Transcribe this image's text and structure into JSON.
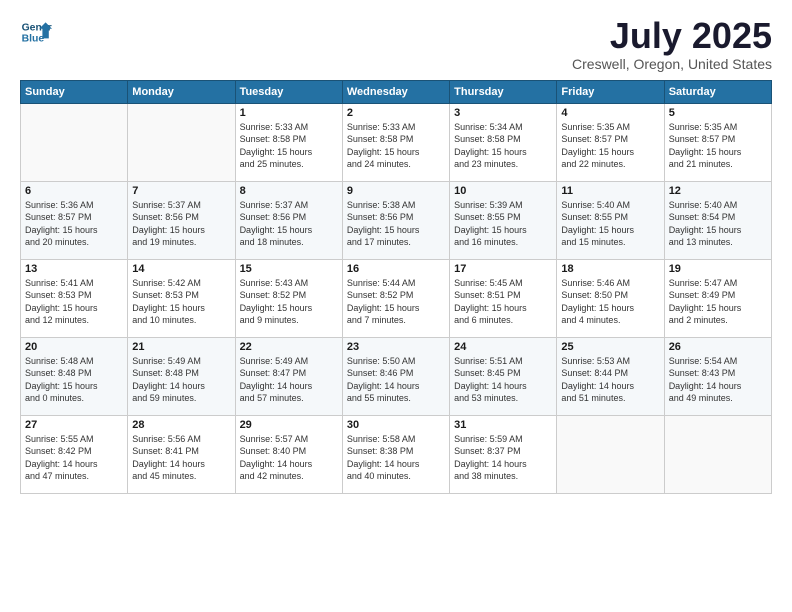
{
  "header": {
    "logo_line1": "General",
    "logo_line2": "Blue",
    "title": "July 2025",
    "subtitle": "Creswell, Oregon, United States"
  },
  "weekdays": [
    "Sunday",
    "Monday",
    "Tuesday",
    "Wednesday",
    "Thursday",
    "Friday",
    "Saturday"
  ],
  "weeks": [
    [
      {
        "day": "",
        "info": ""
      },
      {
        "day": "",
        "info": ""
      },
      {
        "day": "1",
        "info": "Sunrise: 5:33 AM\nSunset: 8:58 PM\nDaylight: 15 hours\nand 25 minutes."
      },
      {
        "day": "2",
        "info": "Sunrise: 5:33 AM\nSunset: 8:58 PM\nDaylight: 15 hours\nand 24 minutes."
      },
      {
        "day": "3",
        "info": "Sunrise: 5:34 AM\nSunset: 8:58 PM\nDaylight: 15 hours\nand 23 minutes."
      },
      {
        "day": "4",
        "info": "Sunrise: 5:35 AM\nSunset: 8:57 PM\nDaylight: 15 hours\nand 22 minutes."
      },
      {
        "day": "5",
        "info": "Sunrise: 5:35 AM\nSunset: 8:57 PM\nDaylight: 15 hours\nand 21 minutes."
      }
    ],
    [
      {
        "day": "6",
        "info": "Sunrise: 5:36 AM\nSunset: 8:57 PM\nDaylight: 15 hours\nand 20 minutes."
      },
      {
        "day": "7",
        "info": "Sunrise: 5:37 AM\nSunset: 8:56 PM\nDaylight: 15 hours\nand 19 minutes."
      },
      {
        "day": "8",
        "info": "Sunrise: 5:37 AM\nSunset: 8:56 PM\nDaylight: 15 hours\nand 18 minutes."
      },
      {
        "day": "9",
        "info": "Sunrise: 5:38 AM\nSunset: 8:56 PM\nDaylight: 15 hours\nand 17 minutes."
      },
      {
        "day": "10",
        "info": "Sunrise: 5:39 AM\nSunset: 8:55 PM\nDaylight: 15 hours\nand 16 minutes."
      },
      {
        "day": "11",
        "info": "Sunrise: 5:40 AM\nSunset: 8:55 PM\nDaylight: 15 hours\nand 15 minutes."
      },
      {
        "day": "12",
        "info": "Sunrise: 5:40 AM\nSunset: 8:54 PM\nDaylight: 15 hours\nand 13 minutes."
      }
    ],
    [
      {
        "day": "13",
        "info": "Sunrise: 5:41 AM\nSunset: 8:53 PM\nDaylight: 15 hours\nand 12 minutes."
      },
      {
        "day": "14",
        "info": "Sunrise: 5:42 AM\nSunset: 8:53 PM\nDaylight: 15 hours\nand 10 minutes."
      },
      {
        "day": "15",
        "info": "Sunrise: 5:43 AM\nSunset: 8:52 PM\nDaylight: 15 hours\nand 9 minutes."
      },
      {
        "day": "16",
        "info": "Sunrise: 5:44 AM\nSunset: 8:52 PM\nDaylight: 15 hours\nand 7 minutes."
      },
      {
        "day": "17",
        "info": "Sunrise: 5:45 AM\nSunset: 8:51 PM\nDaylight: 15 hours\nand 6 minutes."
      },
      {
        "day": "18",
        "info": "Sunrise: 5:46 AM\nSunset: 8:50 PM\nDaylight: 15 hours\nand 4 minutes."
      },
      {
        "day": "19",
        "info": "Sunrise: 5:47 AM\nSunset: 8:49 PM\nDaylight: 15 hours\nand 2 minutes."
      }
    ],
    [
      {
        "day": "20",
        "info": "Sunrise: 5:48 AM\nSunset: 8:48 PM\nDaylight: 15 hours\nand 0 minutes."
      },
      {
        "day": "21",
        "info": "Sunrise: 5:49 AM\nSunset: 8:48 PM\nDaylight: 14 hours\nand 59 minutes."
      },
      {
        "day": "22",
        "info": "Sunrise: 5:49 AM\nSunset: 8:47 PM\nDaylight: 14 hours\nand 57 minutes."
      },
      {
        "day": "23",
        "info": "Sunrise: 5:50 AM\nSunset: 8:46 PM\nDaylight: 14 hours\nand 55 minutes."
      },
      {
        "day": "24",
        "info": "Sunrise: 5:51 AM\nSunset: 8:45 PM\nDaylight: 14 hours\nand 53 minutes."
      },
      {
        "day": "25",
        "info": "Sunrise: 5:53 AM\nSunset: 8:44 PM\nDaylight: 14 hours\nand 51 minutes."
      },
      {
        "day": "26",
        "info": "Sunrise: 5:54 AM\nSunset: 8:43 PM\nDaylight: 14 hours\nand 49 minutes."
      }
    ],
    [
      {
        "day": "27",
        "info": "Sunrise: 5:55 AM\nSunset: 8:42 PM\nDaylight: 14 hours\nand 47 minutes."
      },
      {
        "day": "28",
        "info": "Sunrise: 5:56 AM\nSunset: 8:41 PM\nDaylight: 14 hours\nand 45 minutes."
      },
      {
        "day": "29",
        "info": "Sunrise: 5:57 AM\nSunset: 8:40 PM\nDaylight: 14 hours\nand 42 minutes."
      },
      {
        "day": "30",
        "info": "Sunrise: 5:58 AM\nSunset: 8:38 PM\nDaylight: 14 hours\nand 40 minutes."
      },
      {
        "day": "31",
        "info": "Sunrise: 5:59 AM\nSunset: 8:37 PM\nDaylight: 14 hours\nand 38 minutes."
      },
      {
        "day": "",
        "info": ""
      },
      {
        "day": "",
        "info": ""
      }
    ]
  ]
}
